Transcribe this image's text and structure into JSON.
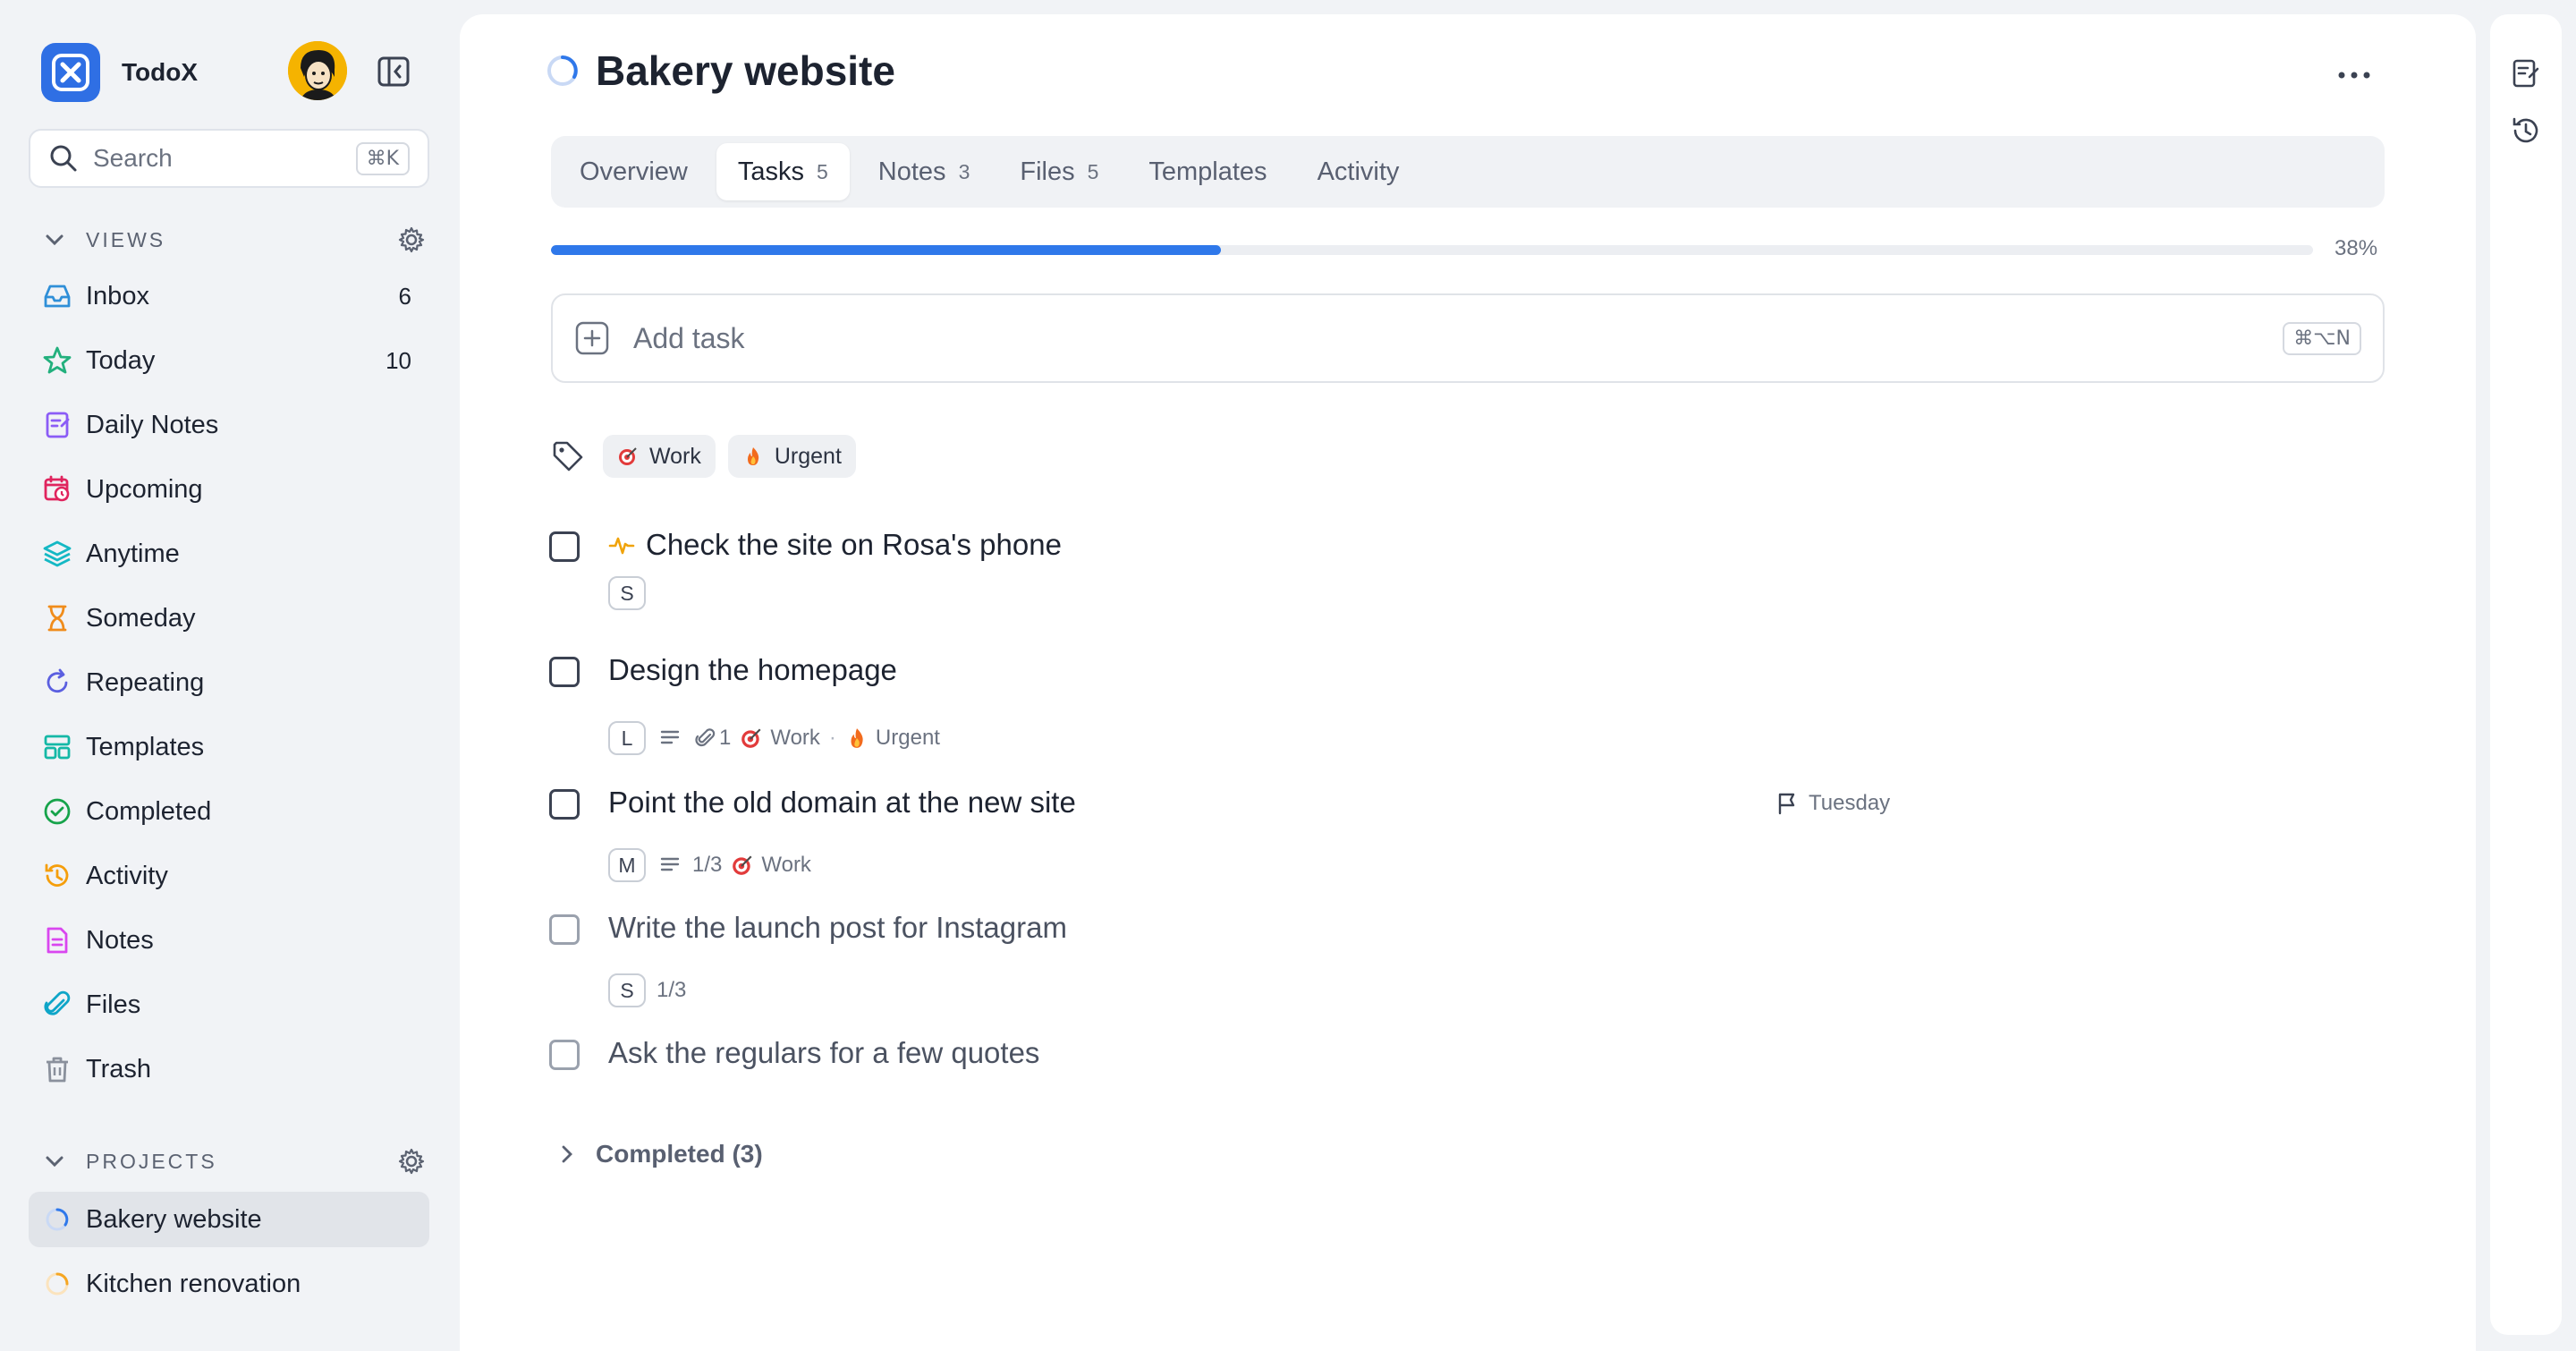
{
  "app": {
    "name": "TodoX"
  },
  "search": {
    "placeholder": "Search",
    "shortcut": "⌘K"
  },
  "views": {
    "header": "VIEWS",
    "items": [
      {
        "label": "Inbox",
        "count": "6",
        "icon": "inbox-icon",
        "color": "#2f8fd8"
      },
      {
        "label": "Today",
        "count": "10",
        "icon": "star-icon",
        "color": "#22b07d"
      },
      {
        "label": "Daily Notes",
        "count": "",
        "icon": "daily-notes-icon",
        "color": "#8b5cf6"
      },
      {
        "label": "Upcoming",
        "count": "",
        "icon": "calendar-clock-icon",
        "color": "#e0245e"
      },
      {
        "label": "Anytime",
        "count": "",
        "icon": "layers-icon",
        "color": "#14b8c4"
      },
      {
        "label": "Someday",
        "count": "",
        "icon": "hourglass-icon",
        "color": "#f08c1b"
      },
      {
        "label": "Repeating",
        "count": "",
        "icon": "repeat-icon",
        "color": "#5b5fe0"
      },
      {
        "label": "Templates",
        "count": "",
        "icon": "templates-icon",
        "color": "#14b8a6"
      },
      {
        "label": "Completed",
        "count": "",
        "icon": "check-circle-icon",
        "color": "#16a34a"
      },
      {
        "label": "Activity",
        "count": "",
        "icon": "history-icon",
        "color": "#f59e0b"
      },
      {
        "label": "Notes",
        "count": "",
        "icon": "note-icon",
        "color": "#d946ef"
      },
      {
        "label": "Files",
        "count": "",
        "icon": "paperclip-icon",
        "color": "#0ea5c8"
      },
      {
        "label": "Trash",
        "count": "",
        "icon": "trash-icon",
        "color": "#8a909c"
      }
    ]
  },
  "projects": {
    "header": "PROJECTS",
    "items": [
      {
        "label": "Bakery website",
        "active": true,
        "color": "#2f78ea"
      },
      {
        "label": "Kitchen renovation",
        "active": false,
        "color": "#f5a623"
      }
    ]
  },
  "project": {
    "title": "Bakery website",
    "progress_percent": 38,
    "progress_label": "38%",
    "tabs": [
      {
        "label": "Overview",
        "count": ""
      },
      {
        "label": "Tasks",
        "count": "5"
      },
      {
        "label": "Notes",
        "count": "3"
      },
      {
        "label": "Files",
        "count": "5"
      },
      {
        "label": "Templates",
        "count": ""
      },
      {
        "label": "Activity",
        "count": ""
      }
    ],
    "active_tab": "Tasks",
    "add_task": {
      "placeholder": "Add task",
      "shortcut": "⌘⌥N"
    },
    "filters": [
      {
        "label": "Work",
        "icon": "target-icon"
      },
      {
        "label": "Urgent",
        "icon": "fire-icon"
      }
    ],
    "tasks": [
      {
        "title": "Check the site on Rosa's phone",
        "size": "S"
      },
      {
        "title": "Design the homepage",
        "size": "L",
        "attachments": "1",
        "tags": [
          "Work",
          "Urgent"
        ]
      },
      {
        "title": "Point the old domain at the new site",
        "size": "M",
        "subtasks": "1/3",
        "tags": [
          "Work"
        ],
        "due": "Tuesday"
      },
      {
        "title": "Write the launch post for Instagram",
        "size": "S",
        "subtasks": "1/3"
      },
      {
        "title": "Ask the regulars for a few quotes"
      }
    ],
    "completed_label": "Completed (3)"
  },
  "colors": {
    "accent": "#2f78ea",
    "logo": "#2f6fe4",
    "pulse": "#f0a30a"
  }
}
